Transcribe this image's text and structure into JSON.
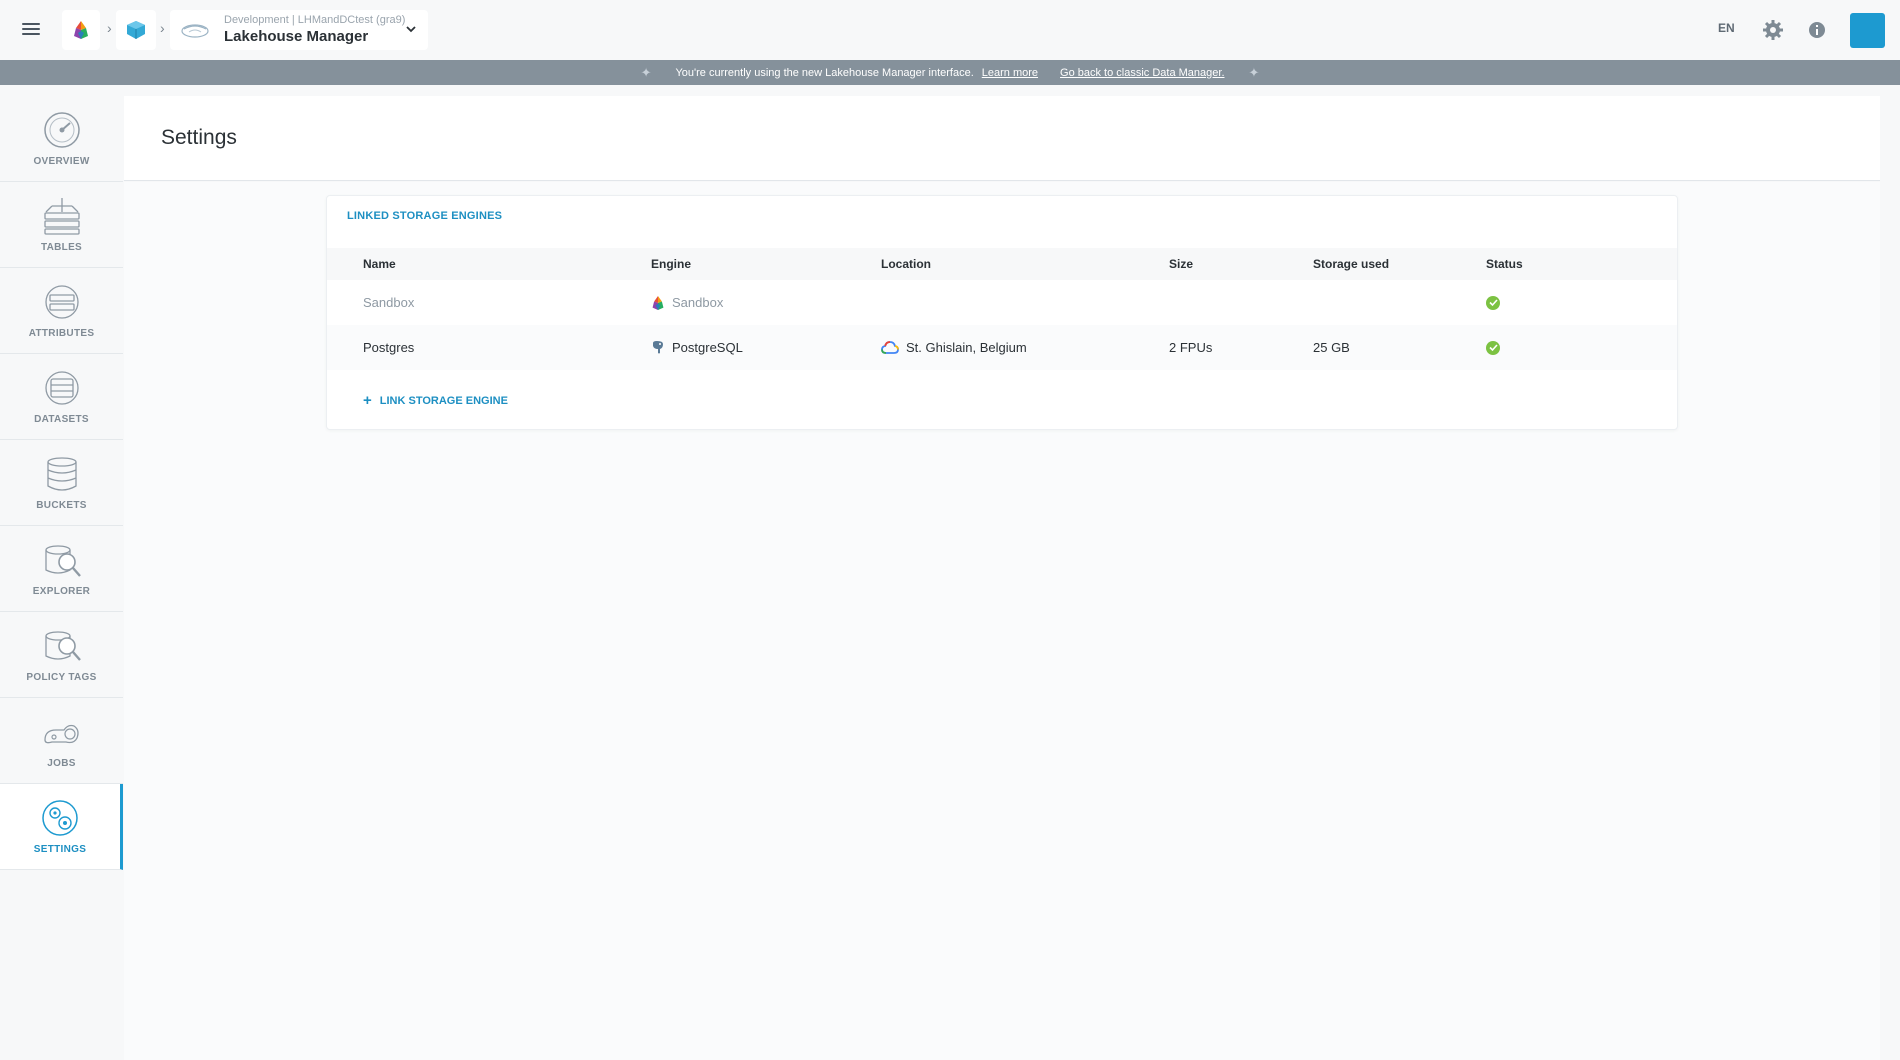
{
  "topbar": {
    "breadcrumb_sub": "Development | LHMandDCtest (gra9)",
    "breadcrumb_title": "Lakehouse Manager",
    "language": "EN"
  },
  "banner": {
    "message": "You're currently using the new Lakehouse Manager interface.",
    "learn_more": "Learn more",
    "go_back": "Go back to classic Data Manager."
  },
  "sidebar": {
    "items": [
      {
        "label": "OVERVIEW",
        "icon": "gauge-icon"
      },
      {
        "label": "TABLES",
        "icon": "tables-icon"
      },
      {
        "label": "ATTRIBUTES",
        "icon": "attributes-icon"
      },
      {
        "label": "DATASETS",
        "icon": "datasets-icon"
      },
      {
        "label": "BUCKETS",
        "icon": "database-icon"
      },
      {
        "label": "EXPLORER",
        "icon": "explorer-icon"
      },
      {
        "label": "POLICY TAGS",
        "icon": "policy-tags-icon"
      },
      {
        "label": "JOBS",
        "icon": "jobs-icon"
      },
      {
        "label": "SETTINGS",
        "icon": "settings-gears-icon"
      }
    ],
    "active": "SETTINGS"
  },
  "page": {
    "title": "Settings"
  },
  "storage": {
    "section_title": "LINKED STORAGE ENGINES",
    "columns": [
      "Name",
      "Engine",
      "Location",
      "Size",
      "Storage used",
      "Status"
    ],
    "rows": [
      {
        "name": "Sandbox",
        "engine": "Sandbox",
        "location": "",
        "size": "",
        "storage_used": "",
        "status": "ok"
      },
      {
        "name": "Postgres",
        "engine": "PostgreSQL",
        "location": "St. Ghislain, Belgium",
        "size": "2 FPUs",
        "storage_used": "25 GB",
        "status": "ok"
      }
    ],
    "link_button": "LINK STORAGE ENGINE"
  },
  "colors": {
    "accent": "#1d9ad0",
    "status_ok": "#7cc242",
    "banner_bg": "#85919b"
  }
}
